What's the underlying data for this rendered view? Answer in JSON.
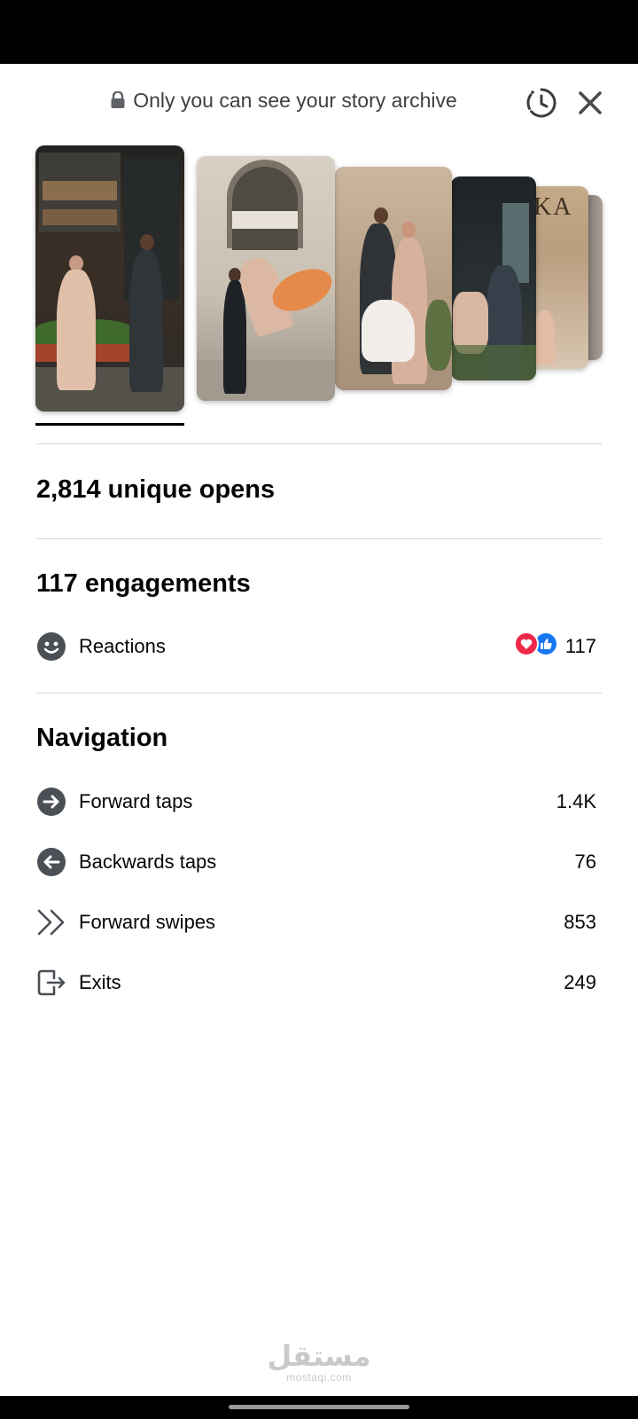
{
  "header": {
    "privacy_text": "Only you can see your story archive",
    "icons": {
      "lock": "lock-icon",
      "archive": "archive-clock-icon",
      "close": "close-icon"
    }
  },
  "stories": [
    {
      "label": "story-1",
      "selected": true
    },
    {
      "label": "story-2",
      "selected": false
    },
    {
      "label": "story-3",
      "selected": false
    },
    {
      "label": "story-4",
      "selected": false
    },
    {
      "label": "story-5",
      "selected": false
    },
    {
      "label": "story-6",
      "selected": false
    }
  ],
  "opens": {
    "text": "2,814 unique opens"
  },
  "engagements": {
    "title": "117 engagements",
    "reactions": {
      "label": "Reactions",
      "value": "117",
      "icon": "smiley-icon",
      "reaction_icons": [
        "love-reaction-icon",
        "like-reaction-icon"
      ]
    }
  },
  "navigation": {
    "title": "Navigation",
    "items": [
      {
        "label": "Forward taps",
        "value": "1.4K",
        "icon": "arrow-right-circle-icon"
      },
      {
        "label": "Backwards taps",
        "value": "76",
        "icon": "arrow-left-circle-icon"
      },
      {
        "label": "Forward swipes",
        "value": "853",
        "icon": "double-chevron-right-icon"
      },
      {
        "label": "Exits",
        "value": "249",
        "icon": "exit-icon"
      }
    ]
  },
  "watermark": {
    "arabic": "مستقل",
    "latin": "mostaqi.com"
  },
  "colors": {
    "love": "#f0284a",
    "like": "#1877f2",
    "icon_gray": "#4b4f56",
    "text": "#050505"
  }
}
